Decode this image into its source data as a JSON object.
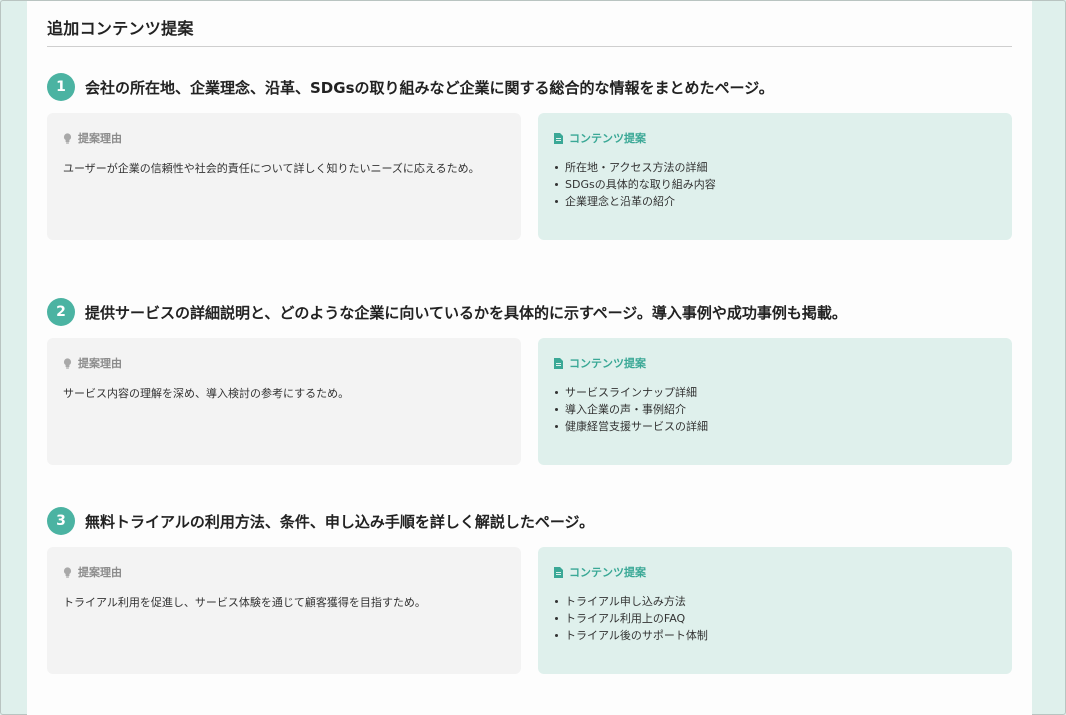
{
  "section": {
    "title": "追加コンテンツ提案"
  },
  "labels": {
    "reason": "提案理由",
    "content": "コンテンツ提案"
  },
  "icons": {
    "reason": "lightbulb-icon",
    "content": "document-icon"
  },
  "colors": {
    "accent": "#4bb3a2",
    "page_background": "#dff0ec",
    "reason_card": "#f3f3f3",
    "content_card": "#dff0ec"
  },
  "items": [
    {
      "number": "1",
      "title": "会社の所在地、企業理念、沿革、SDGsの取り組みなど企業に関する総合的な情報をまとめたページ。",
      "reason": "ユーザーが企業の信頼性や社会的責任について詳しく知りたいニーズに応えるため。",
      "contents": [
        "所在地・アクセス方法の詳細",
        "SDGsの具体的な取り組み内容",
        "企業理念と沿革の紹介"
      ]
    },
    {
      "number": "2",
      "title": "提供サービスの詳細説明と、どのような企業に向いているかを具体的に示すページ。導入事例や成功事例も掲載。",
      "reason": "サービス内容の理解を深め、導入検討の参考にするため。",
      "contents": [
        "サービスラインナップ詳細",
        "導入企業の声・事例紹介",
        "健康経営支援サービスの詳細"
      ]
    },
    {
      "number": "3",
      "title": "無料トライアルの利用方法、条件、申し込み手順を詳しく解説したページ。",
      "reason": "トライアル利用を促進し、サービス体験を通じて顧客獲得を目指すため。",
      "contents": [
        "トライアル申し込み方法",
        "トライアル利用上のFAQ",
        "トライアル後のサポート体制"
      ]
    }
  ]
}
